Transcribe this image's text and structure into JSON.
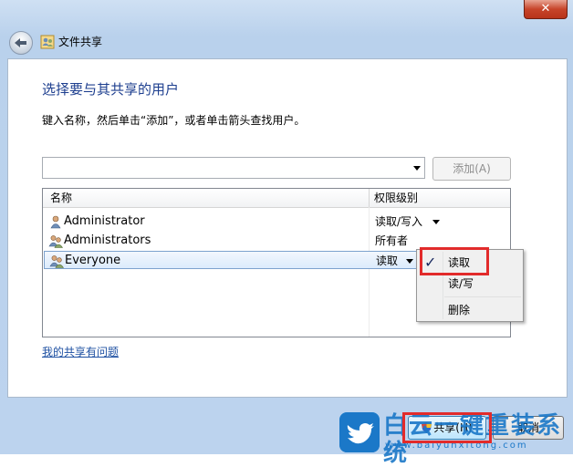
{
  "window": {
    "close_glyph": "✕",
    "title": "文件共享"
  },
  "main": {
    "heading": "选择要与其共享的用户",
    "instruction": "键入名称，然后单击“添加”，或者单击箭头查找用户。",
    "name_input_value": "",
    "add_button": "添加(A)",
    "help_link": "我的共享有问题"
  },
  "table": {
    "columns": [
      "名称",
      "权限级别"
    ],
    "rows": [
      {
        "name": "Administrator",
        "permission": "读取/写入",
        "icon": "user-icon"
      },
      {
        "name": "Administrators",
        "permission": "所有者",
        "icon": "group-icon"
      },
      {
        "name": "Everyone",
        "permission": "读取",
        "icon": "group-icon"
      }
    ]
  },
  "context_menu": {
    "items": [
      {
        "label": "读取",
        "checked": true
      },
      {
        "label": "读/写",
        "checked": false
      },
      {
        "label": "删除",
        "checked": false
      }
    ],
    "check_glyph": "✓"
  },
  "footer": {
    "share_button": "共享(H)",
    "cancel_button": "取消"
  },
  "watermark": {
    "text": "白云一键重装系统",
    "url": "www.baiyunxitong.com"
  },
  "colors": {
    "heading": "#1e3f8f",
    "highlight": "#e22b2b",
    "link": "#1e50a2"
  }
}
